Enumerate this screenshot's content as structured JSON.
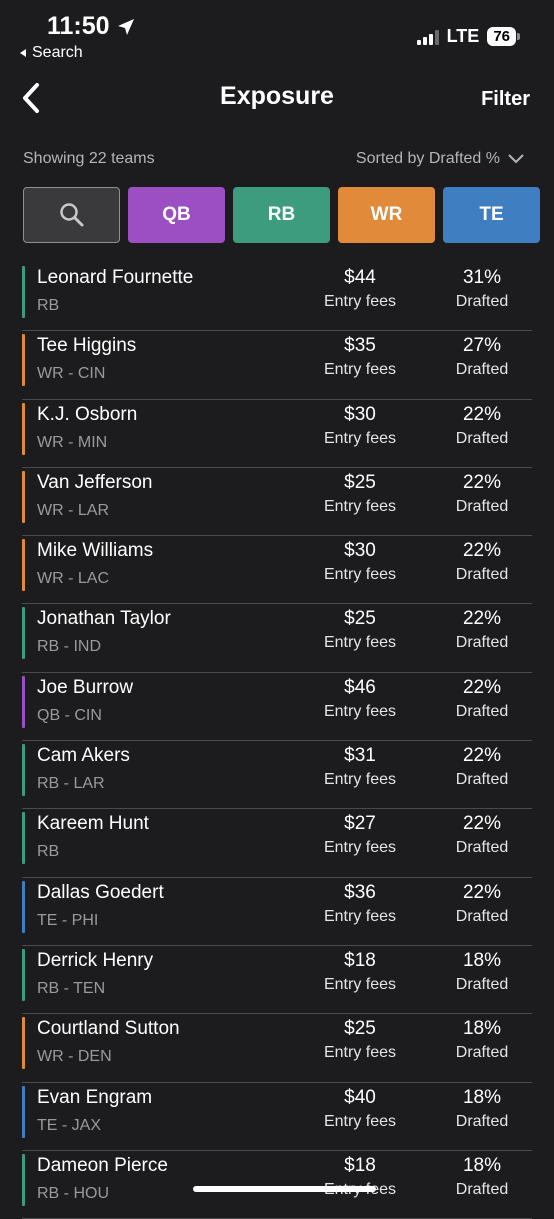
{
  "status": {
    "time": "11:50",
    "back_app": "Search",
    "network": "LTE",
    "battery": "76"
  },
  "nav": {
    "title": "Exposure",
    "filter_label": "Filter"
  },
  "summary": {
    "showing": "Showing 22 teams",
    "sorted_by": "Sorted by Drafted %"
  },
  "filters": [
    {
      "label": "QB",
      "color": "#9b4fc2"
    },
    {
      "label": "RB",
      "color": "#3e9c7e"
    },
    {
      "label": "WR",
      "color": "#e08a3a"
    },
    {
      "label": "TE",
      "color": "#3f7fc1"
    }
  ],
  "labels": {
    "fee_caption": "Entry fees",
    "drafted_caption": "Drafted"
  },
  "players": [
    {
      "name": "Leonard Fournette",
      "pos": "RB",
      "fee": "$44",
      "pct": "31%",
      "color": "#3e9c7e"
    },
    {
      "name": "Tee Higgins",
      "pos": "WR - CIN",
      "fee": "$35",
      "pct": "27%",
      "color": "#e08a3a"
    },
    {
      "name": "K.J. Osborn",
      "pos": "WR - MIN",
      "fee": "$30",
      "pct": "22%",
      "color": "#e08a3a"
    },
    {
      "name": "Van Jefferson",
      "pos": "WR - LAR",
      "fee": "$25",
      "pct": "22%",
      "color": "#e08a3a"
    },
    {
      "name": "Mike Williams",
      "pos": "WR - LAC",
      "fee": "$30",
      "pct": "22%",
      "color": "#e08a3a"
    },
    {
      "name": "Jonathan Taylor",
      "pos": "RB - IND",
      "fee": "$25",
      "pct": "22%",
      "color": "#3e9c7e"
    },
    {
      "name": "Joe Burrow",
      "pos": "QB - CIN",
      "fee": "$46",
      "pct": "22%",
      "color": "#9b4fc2"
    },
    {
      "name": "Cam Akers",
      "pos": "RB - LAR",
      "fee": "$31",
      "pct": "22%",
      "color": "#3e9c7e"
    },
    {
      "name": "Kareem Hunt",
      "pos": "RB",
      "fee": "$27",
      "pct": "22%",
      "color": "#3e9c7e"
    },
    {
      "name": "Dallas Goedert",
      "pos": "TE - PHI",
      "fee": "$36",
      "pct": "22%",
      "color": "#3f7fc1"
    },
    {
      "name": "Derrick Henry",
      "pos": "RB - TEN",
      "fee": "$18",
      "pct": "18%",
      "color": "#3e9c7e"
    },
    {
      "name": "Courtland Sutton",
      "pos": "WR - DEN",
      "fee": "$25",
      "pct": "18%",
      "color": "#e08a3a"
    },
    {
      "name": "Evan Engram",
      "pos": "TE - JAX",
      "fee": "$40",
      "pct": "18%",
      "color": "#3f7fc1"
    },
    {
      "name": "Dameon Pierce",
      "pos": "RB - HOU",
      "fee": "$18",
      "pct": "18%",
      "color": "#3e9c7e"
    }
  ]
}
